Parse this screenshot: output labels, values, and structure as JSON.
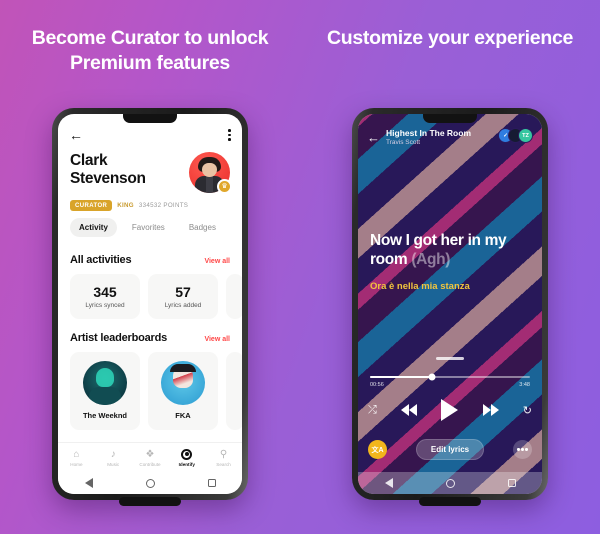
{
  "theme": {
    "bg_gradient_from": "#c154b8",
    "bg_gradient_to": "#8d5ee0",
    "accent_red": "#ff4747",
    "accent_gold": "#d9a42a",
    "lyric_translation_color": "#f2c53d"
  },
  "panels": {
    "left_headline": "Become Curator to unlock Premium features",
    "right_headline": "Customize your experience"
  },
  "profile_screen": {
    "back_icon": "back-arrow-icon",
    "menu_icon": "kebab-menu-icon",
    "user_name": "Clark Stevenson",
    "avatar_badge_icon": "crown-icon",
    "badge_label": "CURATOR",
    "rank_label": "KING",
    "points_label": "334532 POINTS",
    "tabs": [
      {
        "label": "Activity",
        "active": true
      },
      {
        "label": "Favorites",
        "active": false
      },
      {
        "label": "Badges",
        "active": false
      }
    ],
    "activities": {
      "title": "All activities",
      "view_all": "View all",
      "stats": [
        {
          "value": "345",
          "label": "Lyrics synced"
        },
        {
          "value": "57",
          "label": "Lyrics added"
        }
      ]
    },
    "leaderboards": {
      "title": "Artist leaderboards",
      "view_all": "View all",
      "artists": [
        {
          "name": "The Weeknd"
        },
        {
          "name": "FKA"
        }
      ]
    },
    "bottom_nav": [
      {
        "label": "Home",
        "icon": "home-icon",
        "active": false
      },
      {
        "label": "Music",
        "icon": "music-note-icon",
        "active": false
      },
      {
        "label": "Contribute",
        "icon": "contribute-sparkle-icon",
        "active": false
      },
      {
        "label": "Identify",
        "icon": "identify-record-icon",
        "active": true
      },
      {
        "label": "Search",
        "icon": "search-icon",
        "active": false
      }
    ]
  },
  "player_screen": {
    "back_icon": "back-arrow-icon",
    "song_title": "Highest In The Room",
    "artist": "Travis Scott",
    "avatars": [
      {
        "label": "✓",
        "name": "verified-check-avatar"
      },
      {
        "label": "",
        "name": "contributor-avatar"
      },
      {
        "label": "TZ",
        "name": "contributor-avatar-tz"
      }
    ],
    "lyric_line": "Now I got her in my room",
    "lyric_adlib": " (Agh)",
    "lyric_translation": "Ora è nella mia stanza",
    "progress": {
      "elapsed": "00:56",
      "duration": "3:48"
    },
    "controls": [
      {
        "name": "shuffle-icon",
        "glyph": "⤮"
      },
      {
        "name": "previous-icon",
        "glyph": ""
      },
      {
        "name": "play-icon",
        "glyph": ""
      },
      {
        "name": "next-icon",
        "glyph": ""
      },
      {
        "name": "repeat-icon",
        "glyph": "↻"
      }
    ],
    "translate_button": "文A",
    "edit_button": "Edit lyrics",
    "more_button": "more-icon"
  }
}
